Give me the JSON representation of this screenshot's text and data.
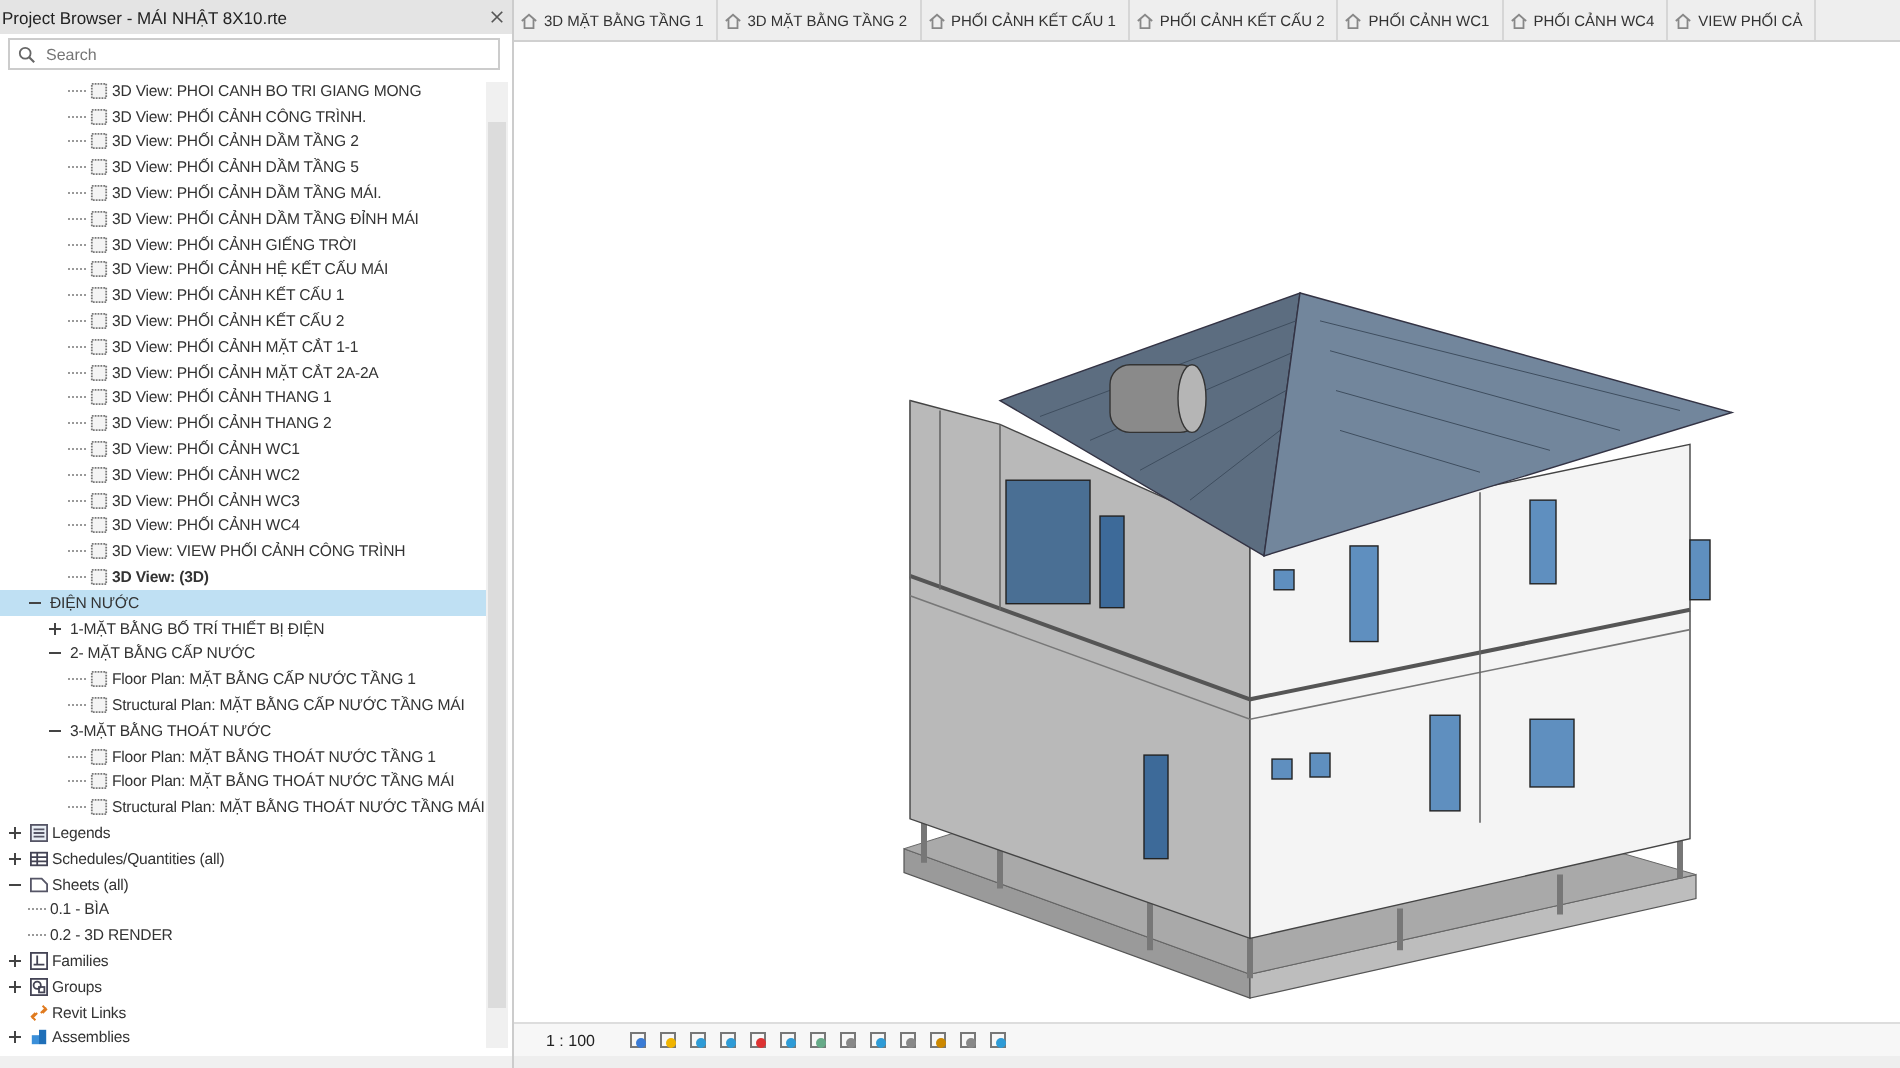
{
  "browser": {
    "title": "Project Browser - MÁI NHẬT 8X10.rte",
    "search": {
      "placeholder": "Search"
    },
    "tree": [
      {
        "children": [
          {
            "children": [
              {
                "children": [
                  {
                    "label": "3D View: PHOI CANH BO TRI GIANG MONG",
                    "kind": "view",
                    "selected": false
                  },
                  {
                    "label": "3D View: PHỐI CẢNH CÔNG TRÌNH.",
                    "kind": "view",
                    "selected": false
                  },
                  {
                    "label": "3D View: PHỐI CẢNH DẦM TẦNG 2",
                    "kind": "view",
                    "selected": false
                  },
                  {
                    "label": "3D View: PHỐI CẢNH DẦM TẦNG 5",
                    "kind": "view",
                    "selected": false
                  },
                  {
                    "label": "3D View: PHỐI CẢNH DẦM TẦNG MÁI.",
                    "kind": "view",
                    "selected": false
                  },
                  {
                    "label": "3D View: PHỐI CẢNH DẦM TẦNG ĐỈNH MÁI",
                    "kind": "view",
                    "selected": false
                  },
                  {
                    "label": "3D View: PHỐI CẢNH GIẾNG TRỜI",
                    "kind": "view",
                    "selected": false
                  },
                  {
                    "label": "3D View: PHỐI CẢNH HỆ KẾT CẤU MÁI",
                    "kind": "view",
                    "selected": false
                  },
                  {
                    "label": "3D View: PHỐI CẢNH KẾT CẤU 1",
                    "kind": "view",
                    "selected": false
                  },
                  {
                    "label": "3D View: PHỐI CẢNH KẾT CẤU 2",
                    "kind": "view",
                    "selected": false
                  },
                  {
                    "label": "3D View: PHỐI CẢNH MẶT CẮT 1-1",
                    "kind": "view",
                    "selected": false
                  },
                  {
                    "label": "3D View: PHỐI CẢNH MẶT CẮT 2A-2A",
                    "kind": "view",
                    "selected": false
                  },
                  {
                    "label": "3D View: PHỐI CẢNH THANG 1",
                    "kind": "view",
                    "selected": false
                  },
                  {
                    "label": "3D View: PHỐI CẢNH THANG 2",
                    "kind": "view",
                    "selected": false
                  },
                  {
                    "label": "3D View: PHỐI CẢNH WC1",
                    "kind": "view",
                    "selected": false
                  },
                  {
                    "label": "3D View: PHỐI CẢNH WC2",
                    "kind": "view",
                    "selected": false
                  },
                  {
                    "label": "3D View: PHỐI CẢNH WC3",
                    "kind": "view",
                    "selected": false
                  },
                  {
                    "label": "3D View: PHỐI CẢNH WC4",
                    "kind": "view",
                    "selected": false
                  },
                  {
                    "label": "3D View: VIEW PHỐI CẢNH CÔNG TRÌNH",
                    "kind": "view",
                    "selected": false
                  },
                  {
                    "label": "3D View: (3D)",
                    "kind": "view",
                    "selected": false,
                    "active": true
                  }
                ]
              }
            ]
          },
          {
            "label": "ĐIỆN NƯỚC",
            "expanded": true,
            "selected": true,
            "children": [
              {
                "label": "1-MẶT BẰNG BỐ TRÍ THIẾT BỊ ĐIỆN",
                "expanded": false,
                "selected": false
              },
              {
                "label": "2- MẶT BẰNG CẤP NƯỚC",
                "expanded": true,
                "selected": false,
                "children": [
                  {
                    "label": "Floor Plan: MẶT BẰNG CẤP NƯỚC TẦNG 1",
                    "kind": "view",
                    "selected": false
                  },
                  {
                    "label": "Structural Plan: MẶT BẰNG CẤP NƯỚC TẦNG MÁI",
                    "kind": "view",
                    "selected": false
                  }
                ]
              },
              {
                "label": "3-MẶT BẰNG THOÁT NƯỚC",
                "expanded": true,
                "selected": false,
                "children": [
                  {
                    "label": "Floor Plan: MẶT BẰNG THOÁT NƯỚC TẦNG 1",
                    "kind": "view",
                    "selected": false
                  },
                  {
                    "label": "Floor Plan: MẶT BẰNG THOÁT NƯỚC TẦNG MÁI",
                    "kind": "view",
                    "selected": false
                  },
                  {
                    "label": "Structural Plan: MẶT BẰNG THOÁT NƯỚC TẦNG MÁI",
                    "kind": "view",
                    "selected": false
                  }
                ]
              }
            ]
          }
        ]
      },
      {
        "label": "Legends",
        "kind": "legend",
        "expanded": false,
        "selected": false
      },
      {
        "label": "Schedules/Quantities (all)",
        "kind": "schedule",
        "expanded": false,
        "selected": false
      },
      {
        "label": "Sheets (all)",
        "kind": "sheet",
        "expanded": true,
        "selected": false,
        "children": [
          {
            "label": "0.1 - BÌA",
            "selected": false
          },
          {
            "label": "0.2 - 3D RENDER",
            "selected": false
          }
        ]
      },
      {
        "label": "Families",
        "kind": "family",
        "expanded": false,
        "selected": false
      },
      {
        "label": "Groups",
        "kind": "group",
        "expanded": false,
        "selected": false
      },
      {
        "label": "Revit Links",
        "kind": "link",
        "selected": false
      },
      {
        "label": "Assemblies",
        "kind": "assembly",
        "expanded": false,
        "selected": false
      }
    ]
  },
  "tabs": [
    "3D MẶT BẰNG TẦNG 1",
    "3D MẶT BẰNG TẦNG 2",
    "PHỐI CẢNH KẾT CẤU 1",
    "PHỐI CẢNH KẾT CẤU 2",
    "PHỐI CẢNH WC1",
    "PHỐI CẢNH WC4",
    "VIEW PHỐI CẢ"
  ],
  "view_bar": {
    "scale": "1 : 100"
  }
}
